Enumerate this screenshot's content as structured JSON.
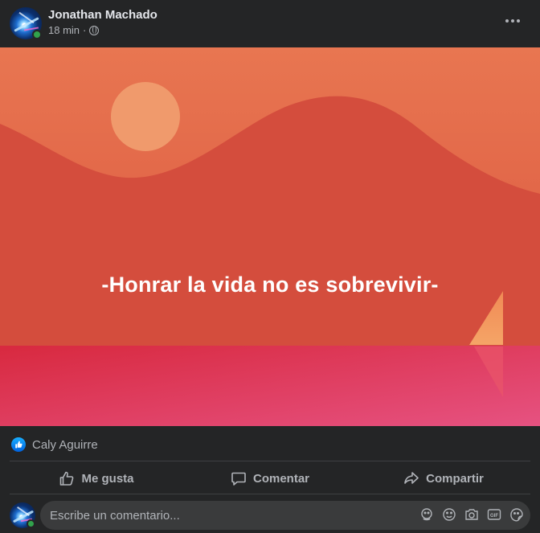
{
  "post": {
    "author": "Jonathan Machado",
    "time": "18 min",
    "separator": "·",
    "privacy_icon": "globe-icon",
    "image_text": "-Honrar la vida no es sobrevivir-",
    "image_colors": {
      "sky_top": "#e7724f",
      "sky_bottom": "#d9533f",
      "mountain": "#d14b3e",
      "sun": "#f39a6c",
      "water_top": "#d9334b",
      "water_bottom": "#e4507a",
      "sail": "#f29a5b"
    }
  },
  "reactions": {
    "icon": "like-icon",
    "names": "Caly Aguirre"
  },
  "actions": {
    "like": "Me gusta",
    "comment": "Comentar",
    "share": "Compartir"
  },
  "comment": {
    "placeholder": "Escribe un comentario...",
    "icons": [
      "avatar-sticker-icon",
      "emoji-icon",
      "camera-icon",
      "gif-icon",
      "sticker-icon"
    ]
  },
  "colors": {
    "background": "#242526",
    "text_primary": "#e4e6eb",
    "text_secondary": "#b0b3b8",
    "accent": "#2d88ff",
    "online": "#31a24c"
  }
}
